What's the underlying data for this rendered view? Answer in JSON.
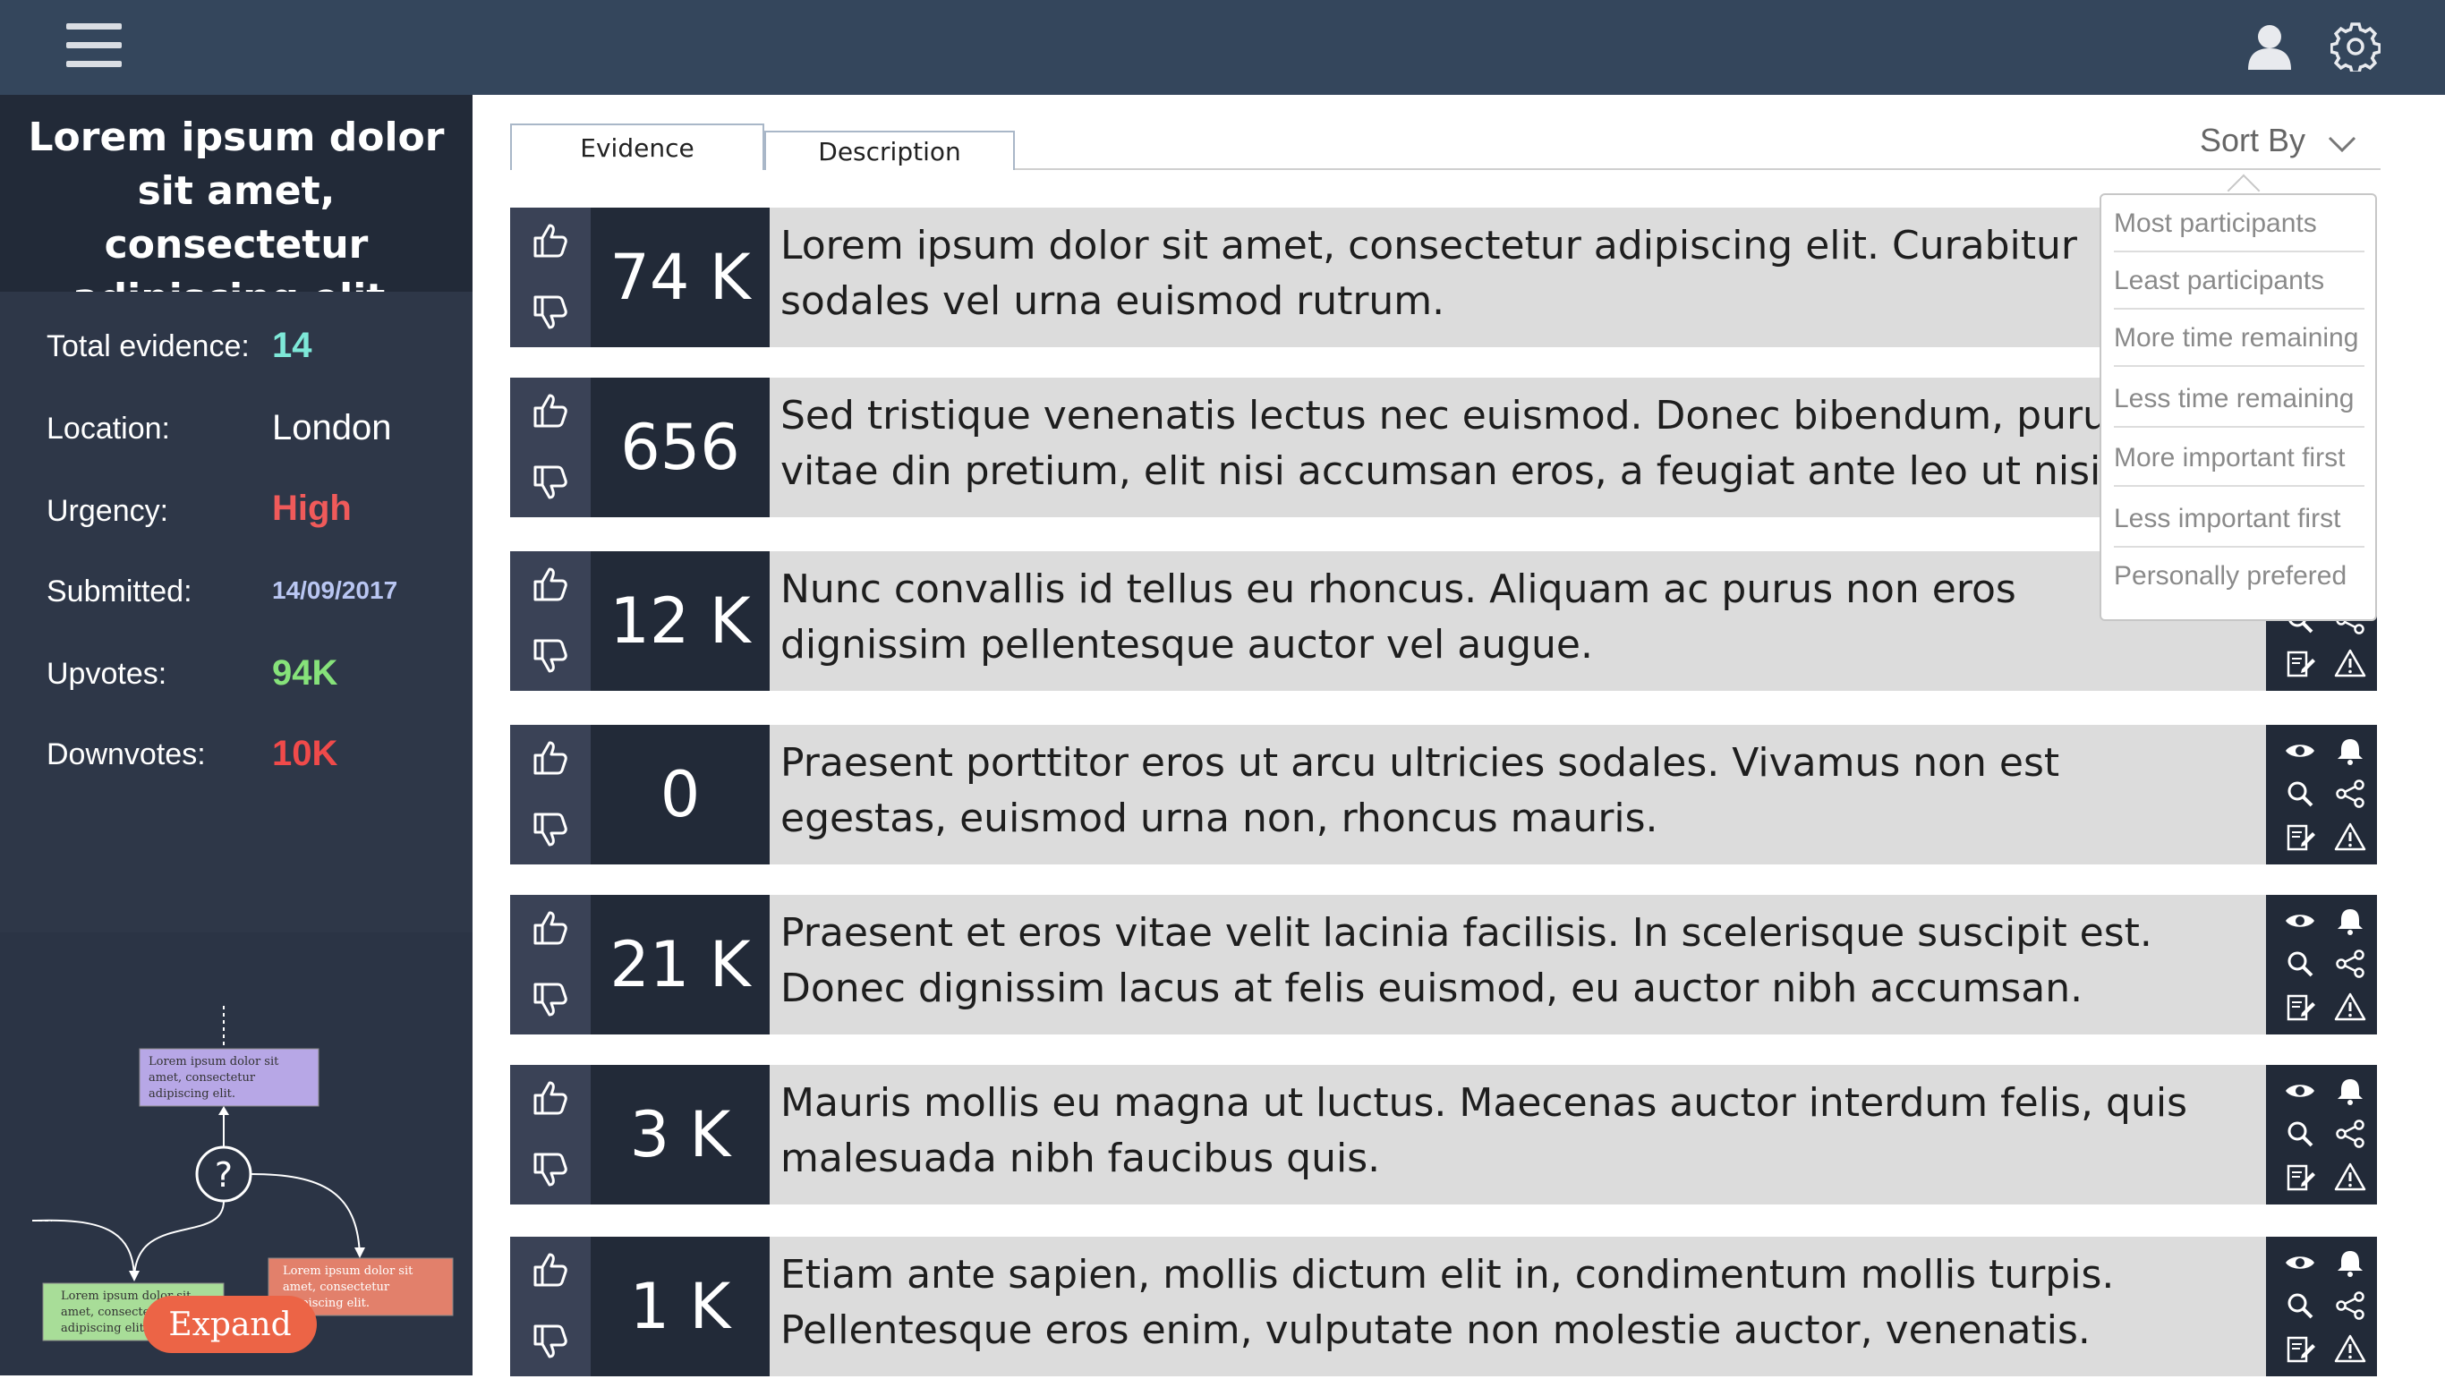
{
  "header": {
    "menu_icon": "hamburger-icon",
    "user_icon": "user-icon",
    "settings_icon": "gear-icon"
  },
  "sidebar": {
    "title": "Lorem ipsum dolor sit amet, consectetur adipiscing elit.",
    "stats": [
      {
        "label": "Total evidence:",
        "value": "14",
        "color": "#7ee8d8"
      },
      {
        "label": "Location:",
        "value": "London",
        "color": "#ffffff"
      },
      {
        "label": "Urgency:",
        "value": "High",
        "color": "#f05a5a"
      },
      {
        "label": "Submitted:",
        "value": "14/09/2017",
        "color": "#b9c6f2"
      },
      {
        "label": "Upvotes:",
        "value": "94K",
        "color": "#86e27a"
      },
      {
        "label": "Downvotes:",
        "value": "10K",
        "color": "#f04a4a"
      }
    ],
    "diagram": {
      "question_mark": "?",
      "boxes": [
        {
          "text": "Lorem ipsum dolor sit amet, consectetur adipiscing elit.",
          "color": "#b7a7e6"
        },
        {
          "text": "Lorem ipsum dolor sit amet, consectetur adipiscing elit.",
          "color": "#a8dd98"
        },
        {
          "text": "Lorem ipsum dolor sit amet, consectetur adipiscing elit.",
          "color": "#e2806b"
        }
      ]
    },
    "expand_label": "Expand"
  },
  "tabs": [
    {
      "label": "Evidence"
    },
    {
      "label": "Description"
    }
  ],
  "sort": {
    "label": "Sort By",
    "options": [
      "Most participants",
      "Least participants",
      "More time remaining",
      "Less time remaining",
      "More important first",
      "Less important first",
      "Personally prefered"
    ]
  },
  "rows": [
    {
      "count": "74 K",
      "text": "Lorem ipsum dolor sit amet, consectetur adipiscing elit. Curabitur sodales vel urna euismod rutrum."
    },
    {
      "count": "656",
      "text": "Sed tristique venenatis lectus nec euismod. Donec bibendum, purus vitae din pretium, elit nisi accumsan eros, a feugiat ante leo ut nisi."
    },
    {
      "count": "12 K",
      "text": "Nunc convallis id tellus eu rhoncus. Aliquam ac purus non eros dignissim pellentesque auctor vel augue."
    },
    {
      "count": "0",
      "text": "Praesent porttitor eros ut arcu ultricies sodales. Vivamus non est egestas, euismod urna non, rhoncus mauris."
    },
    {
      "count": "21 K",
      "text": "Praesent et eros vitae velit lacinia facilisis. In scelerisque suscipit est. Donec dignissim lacus at felis euismod, eu auctor nibh accumsan."
    },
    {
      "count": "3 K",
      "text": "Mauris mollis eu magna ut luctus. Maecenas auctor interdum felis, quis malesuada nibh faucibus quis."
    },
    {
      "count": "1 K",
      "text": "Etiam ante sapien, mollis dictum elit in, condimentum mollis turpis. Pellentesque eros enim, vulputate non molestie auctor, venenatis."
    }
  ],
  "row_actions": [
    "eye-icon",
    "bell-icon",
    "search-icon",
    "share-icon",
    "edit-icon",
    "warning-icon"
  ]
}
